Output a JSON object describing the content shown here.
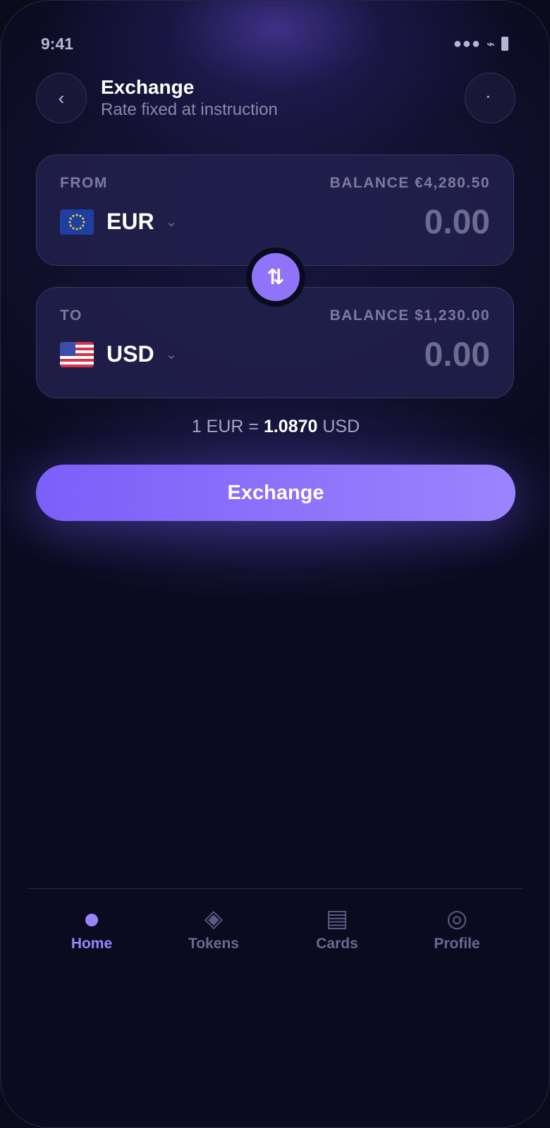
{
  "status_bar": {
    "time": "9:41",
    "signal": "●●●",
    "wifi": "⌁"
  },
  "header": {
    "back_glyph": "‹",
    "title": "Exchange",
    "subtitle": "Rate fixed at instruction",
    "menu_glyph": "⠂"
  },
  "from_card": {
    "label": "FROM",
    "balance": "BALANCE €4,280.50",
    "currency": "EUR",
    "flag": "eu-flag-icon",
    "amount": "0.00"
  },
  "swap": {
    "icon": "swap-vertical-icon",
    "glyph": "⇅"
  },
  "to_card": {
    "label": "TO",
    "balance": "BALANCE $1,230.00",
    "currency": "USD",
    "flag": "us-flag-icon",
    "amount": "0.00"
  },
  "rate": {
    "prefix": "1 EUR =",
    "value": "1.0870",
    "suffix": "USD"
  },
  "exchange_button": {
    "label": "Exchange"
  },
  "tabs": [
    {
      "label": "Home",
      "icon": "dot-icon",
      "active": true
    },
    {
      "label": "Tokens",
      "icon": "diamond-icon",
      "glyph": "◈"
    },
    {
      "label": "Cards",
      "icon": "card-icon",
      "glyph": "▤"
    },
    {
      "label": "Profile",
      "icon": "profile-icon",
      "glyph": "◎"
    }
  ],
  "colors": {
    "accent": "#9a83ff",
    "button_start": "#7b5ff9",
    "button_end": "#9b84fd",
    "background": "#0b0b20"
  }
}
